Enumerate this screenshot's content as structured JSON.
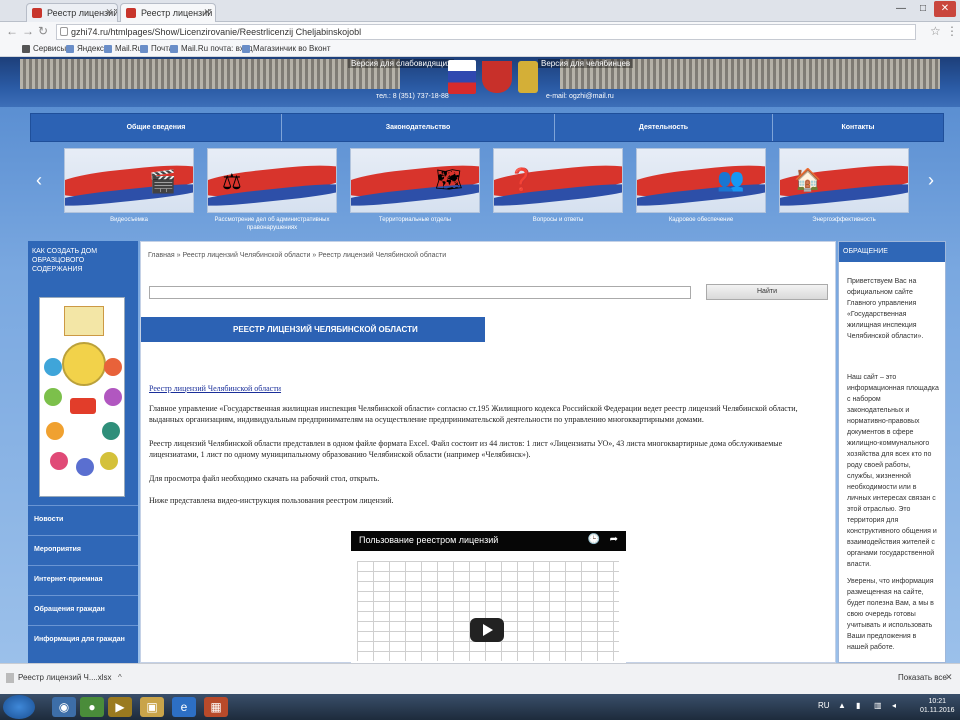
{
  "browser": {
    "tabs": [
      {
        "title": "Реестр лицензий Челяб"
      },
      {
        "title": "Реестр лицензий Челя"
      }
    ],
    "window_controls": {
      "minimize": "—",
      "maximize": "□",
      "close": "✕"
    },
    "url": "gzhi74.ru/htmlpages/Show/Licenzirovanie/Reestrlicenzij Cheljabinskojobl",
    "bookmarks": [
      "Сервисы",
      "Яндекс",
      "Mail.Ru",
      "Почта",
      "Mail.Ru почта: вход",
      "Магазинчик во Вконт"
    ]
  },
  "site": {
    "header": {
      "version_text_left": "Версия для слабовидящих",
      "version_text_right": "Версия для челябинцев",
      "phone": "тел.: 8 (351) 737-18-88",
      "email": "e-mail: ogzhi@mail.ru"
    },
    "nav": [
      "Общие сведения",
      "Законодательство",
      "Деятельность",
      "Контакты"
    ],
    "carousel": {
      "prev": "‹",
      "next": "›",
      "items": [
        {
          "label": "Видеосъемка",
          "icon": "🎬"
        },
        {
          "label": "Рассмотрение дел об административных правонарушениях",
          "icon": "⚖"
        },
        {
          "label": "Территориальные отделы",
          "icon": "🗺"
        },
        {
          "label": "Вопросы и ответы",
          "icon": "❓"
        },
        {
          "label": "Кадровое обеспечение",
          "icon": "👥"
        },
        {
          "label": "Энергоэффективность",
          "icon": "🏠"
        }
      ]
    },
    "left_sidebar": {
      "heading": "КАК СОЗДАТЬ ДОМ ОБРАЗЦОВОГО СОДЕРЖАНИЯ",
      "menu": [
        "Новости",
        "Мероприятия",
        "Интернет-приемная",
        "Обращения граждан",
        "Информация для граждан"
      ]
    },
    "center": {
      "breadcrumb": [
        "Главная",
        "Реестр лицензий Челябинской области",
        "Реестр лицензий Челябинской области"
      ],
      "breadcrumb_sep": "»",
      "search_button": "Найти",
      "title": "РЕЕСТР ЛИЦЕНЗИЙ ЧЕЛЯБИНСКОЙ ОБЛАСТИ",
      "link_text": "Реестр лицензий Челябинской области",
      "paragraphs": [
        "Главное управление «Государственная жилищная инспекция Челябинской области» согласно ст.195 Жилищного кодекса Российской Федерации ведет реестр лицензий Челябинской области, выданных организациям, индивидуальным предпринимателям на осуществление предпринимательской деятельности по управлению многоквартирными домами.",
        "Реестр лицензий Челябинской области представлен в одном файле формата Excel. Файл состоит из 44 листов: 1 лист «Лицензиаты УО», 43 листа многоквартирные дома обслуживаемые лицензиатами, 1 лист по одному муниципальному образованию Челябинской области (например «Челябинск»).",
        "Для просмотра файл необходимо скачать на рабочий стол, открыть.",
        "Ниже представлена видео-инструкция пользования реестром лицензий."
      ],
      "video": {
        "title": "Пользование реестром лицензий",
        "clock_icon": "🕒",
        "share_icon": "➦"
      }
    },
    "right_sidebar": {
      "heading": "ОБРАЩЕНИЕ",
      "paragraphs": [
        "Приветствуем Вас на официальном сайте Главного управления «Государственная жилищная инспекция Челябинской области».",
        "Наш сайт – это информационная площадка с набором законодательных и нормативно-правовых документов в сфере жилищно-коммунального хозяйства для всех кто по роду своей работы, службы, жизненной необходимости или в личных интересах связан с этой отраслью. Это территория для конструктивного общения и взаимодействия жителей с органами государственной власти.",
        "Уверены, что информация размещенная на сайте, будет полезна Вам, а мы в свою очередь готовы учитывать и использовать Ваши предложения в нашей работе."
      ]
    }
  },
  "download_bar": {
    "item": "Реестр лицензий Ч....xlsx",
    "item_caret": "^",
    "show_all": "Показать все",
    "close": "✕"
  },
  "taskbar": {
    "lang": "RU",
    "time": "10:21",
    "date": "01.11.2016"
  }
}
